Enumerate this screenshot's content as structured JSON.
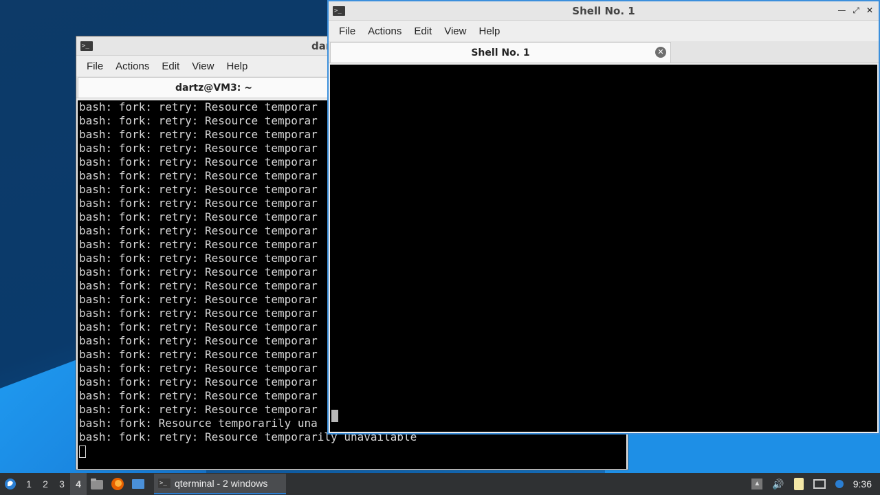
{
  "taskbar": {
    "workspaces": [
      "1",
      "2",
      "3",
      "4"
    ],
    "active_workspace": "4",
    "task_label": "qterminal - 2 windows",
    "clock": "9:36"
  },
  "back_window": {
    "title": "dartz@VM3: ~",
    "title_partial": "dar",
    "menu": [
      "File",
      "Actions",
      "Edit",
      "View",
      "Help"
    ],
    "tab_label": "dartz@VM3: ~",
    "lines": [
      "bash: fork: retry: Resource temporar",
      "bash: fork: retry: Resource temporar",
      "bash: fork: retry: Resource temporar",
      "bash: fork: retry: Resource temporar",
      "bash: fork: retry: Resource temporar",
      "bash: fork: retry: Resource temporar",
      "bash: fork: retry: Resource temporar",
      "bash: fork: retry: Resource temporar",
      "bash: fork: retry: Resource temporar",
      "bash: fork: retry: Resource temporar",
      "bash: fork: retry: Resource temporar",
      "bash: fork: retry: Resource temporar",
      "bash: fork: retry: Resource temporar",
      "bash: fork: retry: Resource temporar",
      "bash: fork: retry: Resource temporar",
      "bash: fork: retry: Resource temporar",
      "bash: fork: retry: Resource temporar",
      "bash: fork: retry: Resource temporar",
      "bash: fork: retry: Resource temporar",
      "bash: fork: retry: Resource temporar",
      "bash: fork: retry: Resource temporar",
      "bash: fork: retry: Resource temporar",
      "bash: fork: retry: Resource temporar",
      "bash: fork: Resource temporarily una",
      "bash: fork: retry: Resource temporarily unavailable"
    ]
  },
  "front_window": {
    "title": "Shell No. 1",
    "menu": [
      "File",
      "Actions",
      "Edit",
      "View",
      "Help"
    ],
    "tab_label": "Shell No. 1"
  },
  "colors": {
    "accent": "#3b8fdc",
    "terminal_bg": "#000000",
    "terminal_fg": "#d8d8d8",
    "taskbar_bg": "#2f3133"
  }
}
